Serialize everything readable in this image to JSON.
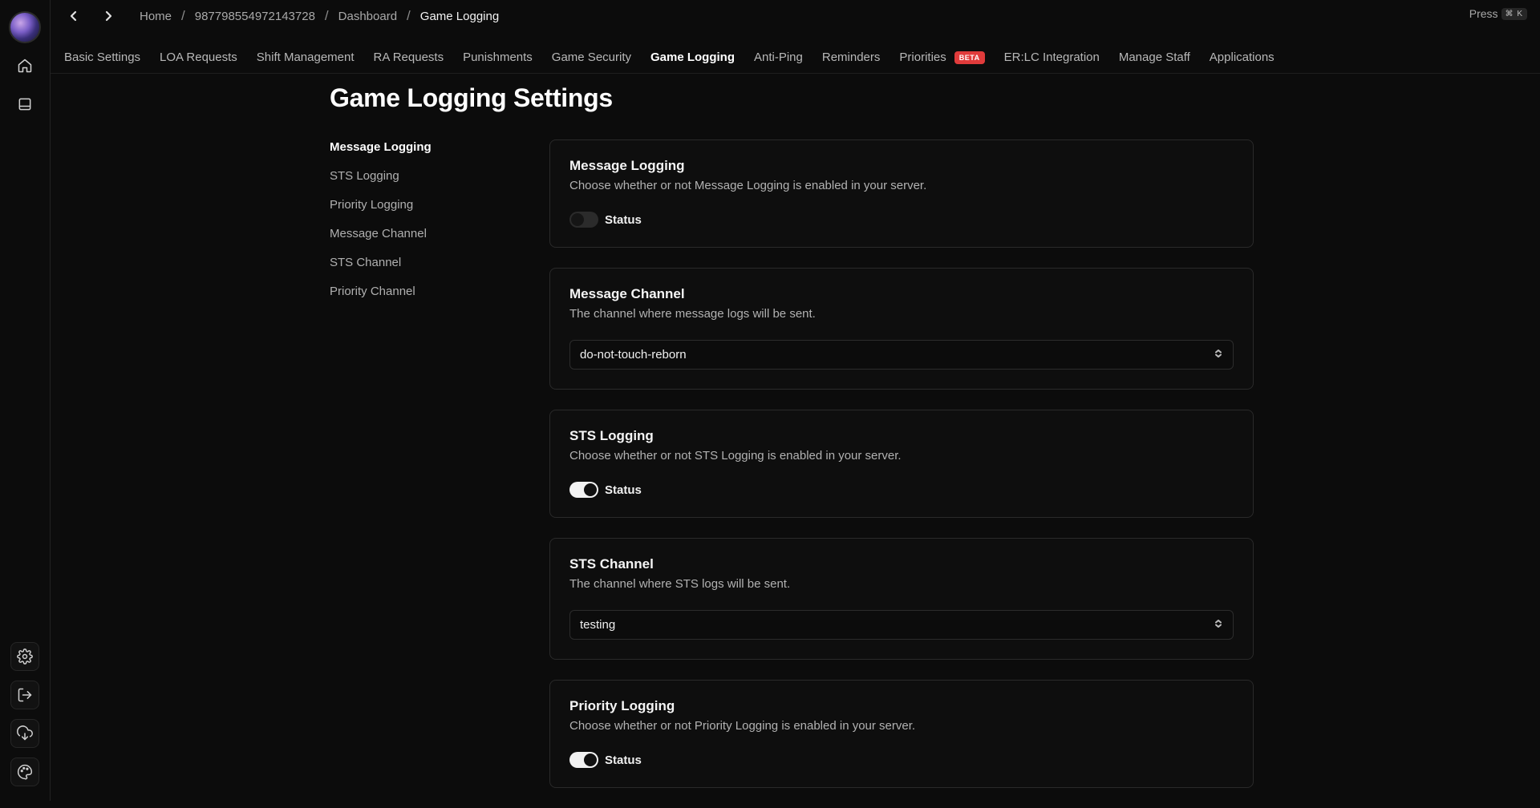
{
  "breadcrumb": {
    "items": [
      "Home",
      "987798554972143728",
      "Dashboard",
      "Game Logging"
    ],
    "separator": "/"
  },
  "command_hint": {
    "label": "Press",
    "shortcut": "⌘ K"
  },
  "tabs": [
    {
      "label": "Basic Settings"
    },
    {
      "label": "LOA Requests"
    },
    {
      "label": "Shift Management"
    },
    {
      "label": "RA Requests"
    },
    {
      "label": "Punishments"
    },
    {
      "label": "Game Security"
    },
    {
      "label": "Game Logging",
      "active": true
    },
    {
      "label": "Anti-Ping"
    },
    {
      "label": "Reminders"
    },
    {
      "label": "Priorities",
      "badge": "BETA"
    },
    {
      "label": "ER:LC Integration"
    },
    {
      "label": "Manage Staff"
    },
    {
      "label": "Applications"
    }
  ],
  "page_title": "Game Logging Settings",
  "side_nav": [
    "Message Logging",
    "STS Logging",
    "Priority Logging",
    "Message Channel",
    "STS Channel",
    "Priority Channel"
  ],
  "cards": {
    "message_logging": {
      "title": "Message Logging",
      "description": "Choose whether or not Message Logging is enabled in your server.",
      "toggle_label": "Status",
      "enabled": false
    },
    "message_channel": {
      "title": "Message Channel",
      "description": "The channel where message logs will be sent.",
      "selected": "do-not-touch-reborn"
    },
    "sts_logging": {
      "title": "STS Logging",
      "description": "Choose whether or not STS Logging is enabled in your server.",
      "toggle_label": "Status",
      "enabled": true
    },
    "sts_channel": {
      "title": "STS Channel",
      "description": "The channel where STS logs will be sent.",
      "selected": "testing"
    },
    "priority_logging": {
      "title": "Priority Logging",
      "description": "Choose whether or not Priority Logging is enabled in your server.",
      "toggle_label": "Status",
      "enabled": true
    }
  },
  "colors": {
    "background": "#0c0c0c",
    "beta_badge": "#e03b3b",
    "toggle_on": "#f2f2f2",
    "toggle_off": "#2b2b2b"
  },
  "icons": {
    "rail_top": [
      "home-icon",
      "panel-icon"
    ],
    "rail_bottom": [
      "settings-icon",
      "logout-icon",
      "cloud-download-icon",
      "palette-icon"
    ]
  }
}
